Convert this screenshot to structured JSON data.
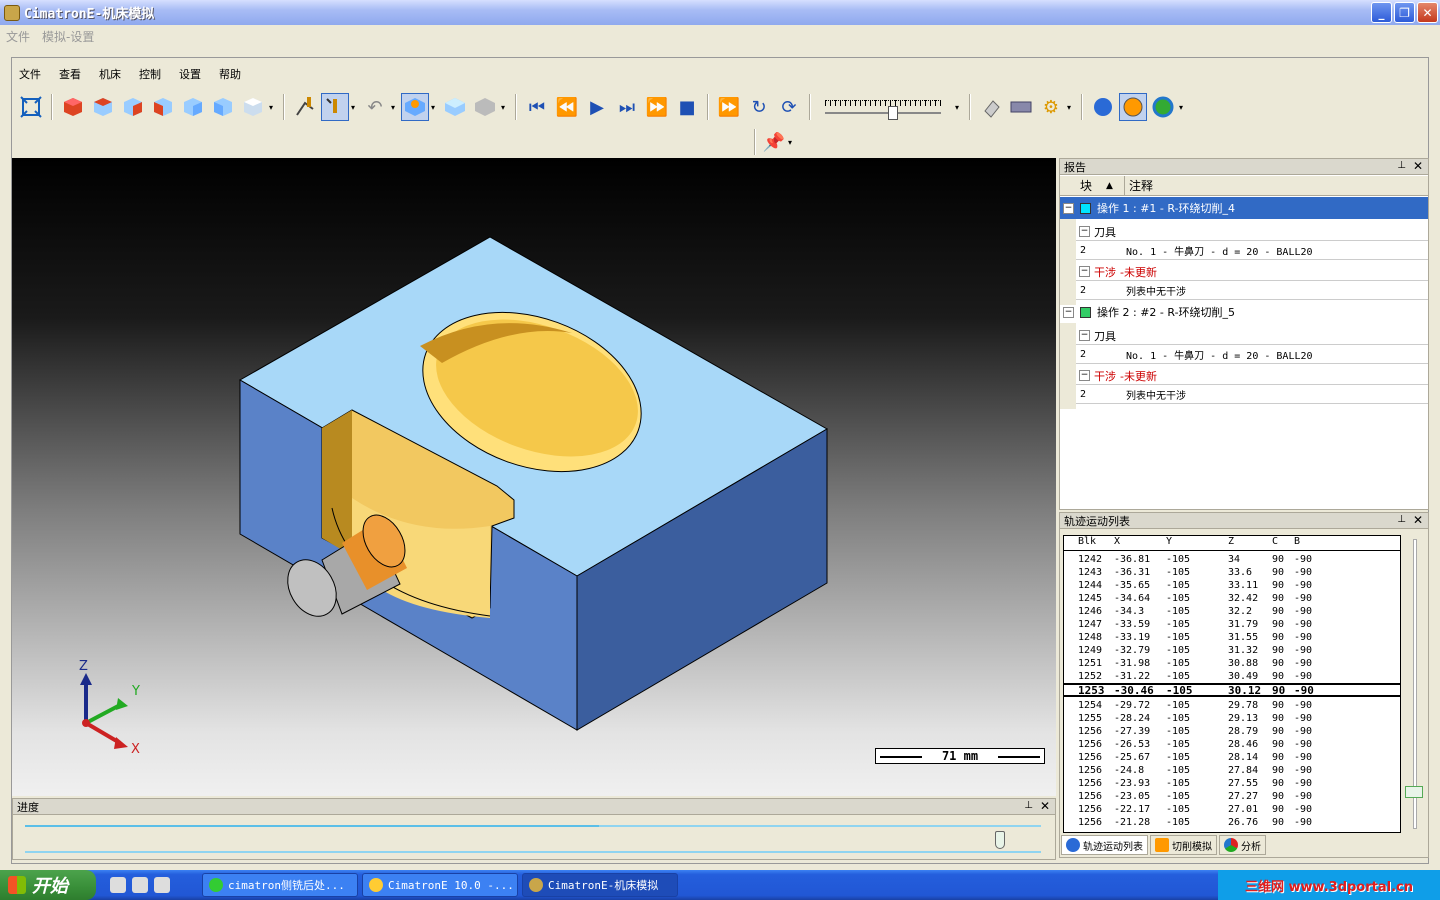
{
  "window": {
    "title": "CimatronE-机床模拟",
    "buttons": {
      "minimize": "_",
      "restore": "❐",
      "close": "✕"
    }
  },
  "outer_menu": [
    "文件",
    "模拟-设置"
  ],
  "inner_menu": [
    "文件",
    "查看",
    "机床",
    "控制",
    "设置",
    "帮助"
  ],
  "viewport": {
    "scale_label": "71 mm",
    "axes": {
      "z": "Z",
      "y": "Y",
      "x": "X"
    }
  },
  "report": {
    "title": "报告",
    "col_block": "块",
    "col_note": "注释",
    "operations": [
      {
        "label": "操作 1 : #1 - R-环绕切削_4",
        "color": "#00e5ff",
        "tool_header": "刀具",
        "tool_block": "2",
        "tool_note": "No. 1 - 牛鼻刀 - d = 20 - BALL20",
        "interf_header": "干涉",
        "interf_status": "-未更新",
        "interf_block": "2",
        "interf_note": "列表中无干涉"
      },
      {
        "label": "操作 2 : #2 - R-环绕切削_5",
        "color": "#33cc66",
        "tool_header": "刀具",
        "tool_block": "2",
        "tool_note": "No. 1 - 牛鼻刀 - d = 20 - BALL20",
        "interf_header": "干涉",
        "interf_status": "-未更新",
        "interf_block": "2",
        "interf_note": "列表中无干涉"
      }
    ]
  },
  "trajectory": {
    "title": "轨迹运动列表",
    "columns": [
      "Blk",
      "X",
      "Y",
      "Z",
      "C",
      "B"
    ],
    "rows_before": [
      [
        "1242",
        "-36.81",
        "-105",
        "34",
        "90",
        "-90"
      ],
      [
        "1243",
        "-36.31",
        "-105",
        "33.6",
        "90",
        "-90"
      ],
      [
        "1244",
        "-35.65",
        "-105",
        "33.11",
        "90",
        "-90"
      ],
      [
        "1245",
        "-34.64",
        "-105",
        "32.42",
        "90",
        "-90"
      ],
      [
        "1246",
        "-34.3",
        "-105",
        "32.2",
        "90",
        "-90"
      ],
      [
        "1247",
        "-33.59",
        "-105",
        "31.79",
        "90",
        "-90"
      ],
      [
        "1248",
        "-33.19",
        "-105",
        "31.55",
        "90",
        "-90"
      ],
      [
        "1249",
        "-32.79",
        "-105",
        "31.32",
        "90",
        "-90"
      ],
      [
        "1251",
        "-31.98",
        "-105",
        "30.88",
        "90",
        "-90"
      ],
      [
        "1252",
        "-31.22",
        "-105",
        "30.49",
        "90",
        "-90"
      ]
    ],
    "current_row": [
      "1253",
      "-30.46",
      "-105",
      "30.12",
      "90",
      "-90"
    ],
    "rows_after": [
      [
        "1254",
        "-29.72",
        "-105",
        "29.78",
        "90",
        "-90"
      ],
      [
        "1255",
        "-28.24",
        "-105",
        "29.13",
        "90",
        "-90"
      ],
      [
        "1256",
        "-27.39",
        "-105",
        "28.79",
        "90",
        "-90"
      ],
      [
        "1256",
        "-26.53",
        "-105",
        "28.46",
        "90",
        "-90"
      ],
      [
        "1256",
        "-25.67",
        "-105",
        "28.14",
        "90",
        "-90"
      ],
      [
        "1256",
        "-24.8",
        "-105",
        "27.84",
        "90",
        "-90"
      ],
      [
        "1256",
        "-23.93",
        "-105",
        "27.55",
        "90",
        "-90"
      ],
      [
        "1256",
        "-23.05",
        "-105",
        "27.27",
        "90",
        "-90"
      ],
      [
        "1256",
        "-22.17",
        "-105",
        "27.01",
        "90",
        "-90"
      ],
      [
        "1256",
        "-21.28",
        "-105",
        "26.76",
        "90",
        "-90"
      ]
    ],
    "tabs": [
      "轨迹运动列表",
      "切削模拟",
      "分析"
    ]
  },
  "progress": {
    "title": "进度",
    "fraction": 0.565,
    "slider_fraction": 0.96
  },
  "taskbar": {
    "start": "开始",
    "tasks": [
      "cimatron侧铣后处...",
      "CimatronE 10.0 -...",
      "CimatronE-机床模拟"
    ],
    "watermark": "三维网 www.3dportal.cn"
  },
  "colors": {
    "accent": "#316ac5",
    "part_top": "#a8d8f8",
    "part_side": "#5a82c8",
    "pocket": "#f0c050",
    "tool": "#e8902a"
  }
}
